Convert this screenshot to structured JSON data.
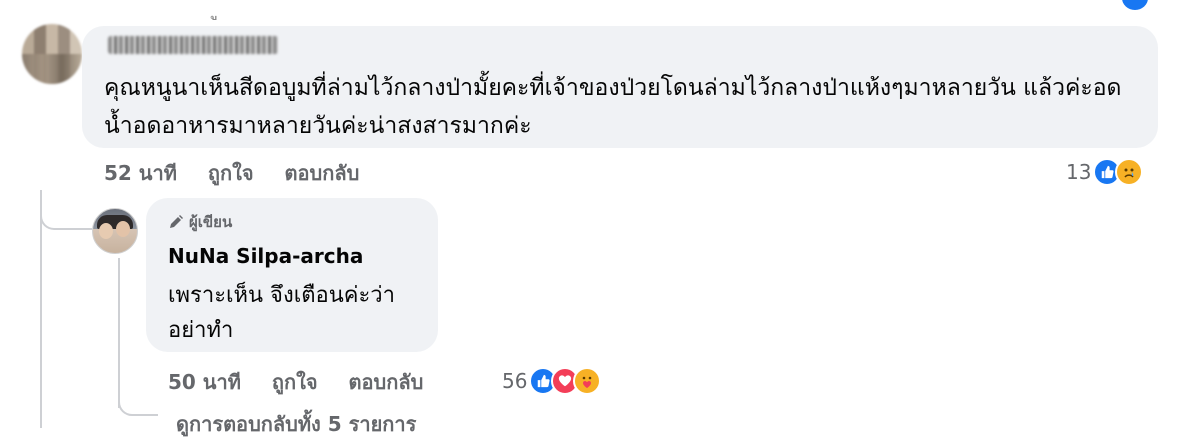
{
  "top": {
    "reaction_icon": "like-icon"
  },
  "comment": {
    "author_blurred": true,
    "text": "คุณหนูนาเห็นสีดอบูมที่ล่ามไว้กลางป่ามั้ยคะที่เจ้าของป่วยโดนล่ามไว้กลางป่าแห้งๆมาหลายวัน แล้วค่ะอดน้ำอดอาหารมาหลายวันค่ะน่าสงสารมากค่ะ",
    "time": "52 นาที",
    "like_label": "ถูกใจ",
    "reply_label": "ตอบกลับ",
    "reaction_count": "13",
    "reactions": [
      "like-icon",
      "sad-icon"
    ]
  },
  "reply": {
    "badge": "ผู้เขียน",
    "author": "NuNa Silpa-archa",
    "lines": [
      "เพราะเห็น จึงเตือนค่ะว่า",
      "อย่าทำ"
    ],
    "time": "50 นาที",
    "like_label": "ถูกใจ",
    "reply_label": "ตอบกลับ",
    "reaction_count": "56",
    "reactions": [
      "like-icon",
      "love-icon",
      "care-icon"
    ]
  },
  "more_replies": "ดูการตอบกลับทั้ง 5 รายการ",
  "colors": {
    "bubble": "#f0f2f5",
    "meta": "#65676b",
    "like": "#1877f2",
    "love": "#f33e58",
    "sad": "#f7b125"
  }
}
